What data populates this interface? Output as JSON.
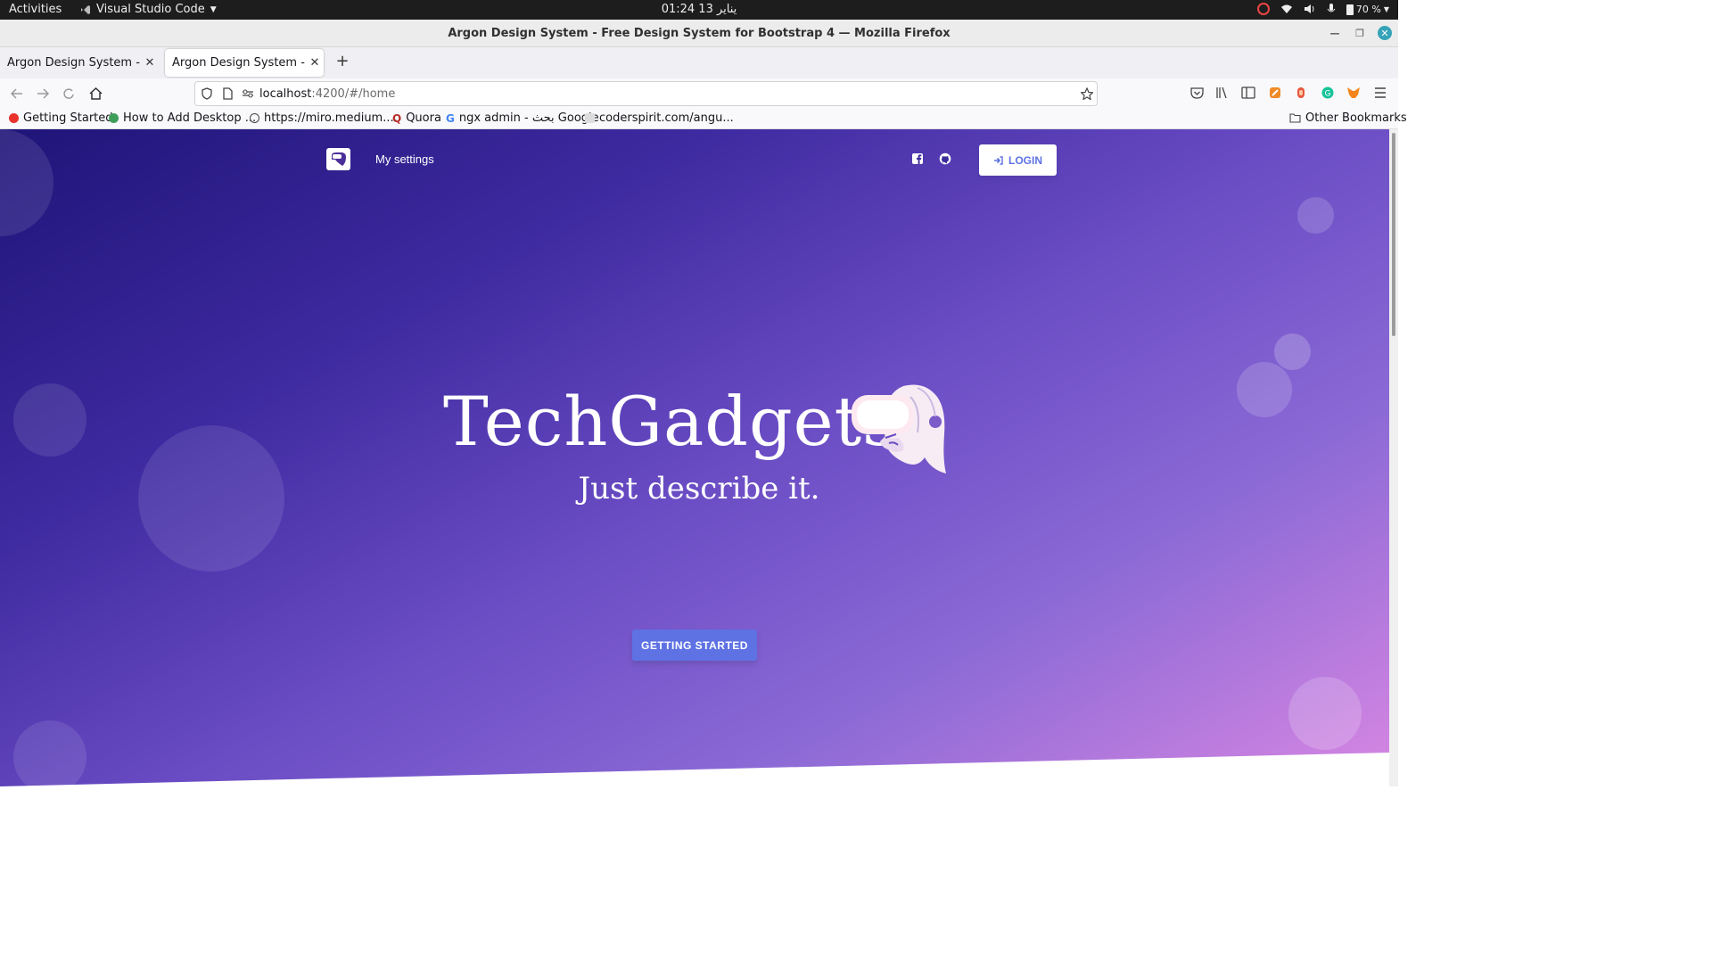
{
  "system": {
    "activities": "Activities",
    "app_name": "Visual Studio Code",
    "clock": "01:24  13 يناير",
    "battery": "70 %"
  },
  "window": {
    "title": "Argon Design System - Free Design System for Bootstrap 4 — Mozilla Firefox"
  },
  "tabs": [
    {
      "label": "Argon Design System - Free D",
      "active": false
    },
    {
      "label": "Argon Design System - Free D",
      "active": true
    }
  ],
  "url": {
    "host": "localhost",
    "path": ":4200/#/home"
  },
  "bookmarks": [
    {
      "label": "Getting Started"
    },
    {
      "label": "How to Add Desktop ..."
    },
    {
      "label": "https://miro.medium...."
    },
    {
      "label": "Quora"
    },
    {
      "label": "ngx admin - بحث Google"
    },
    {
      "label": "coderspirit.com/angu..."
    },
    {
      "label": "Other Bookmarks"
    }
  ],
  "site": {
    "nav_link": "My settings",
    "login_label": "LOGIN",
    "brand": "TechGadgets",
    "tagline": "Just describe it.",
    "cta": "GETTING STARTED"
  },
  "colors": {
    "primary": "#5e72e4",
    "gradient_start": "#1f1478",
    "gradient_end": "#d887e3"
  }
}
